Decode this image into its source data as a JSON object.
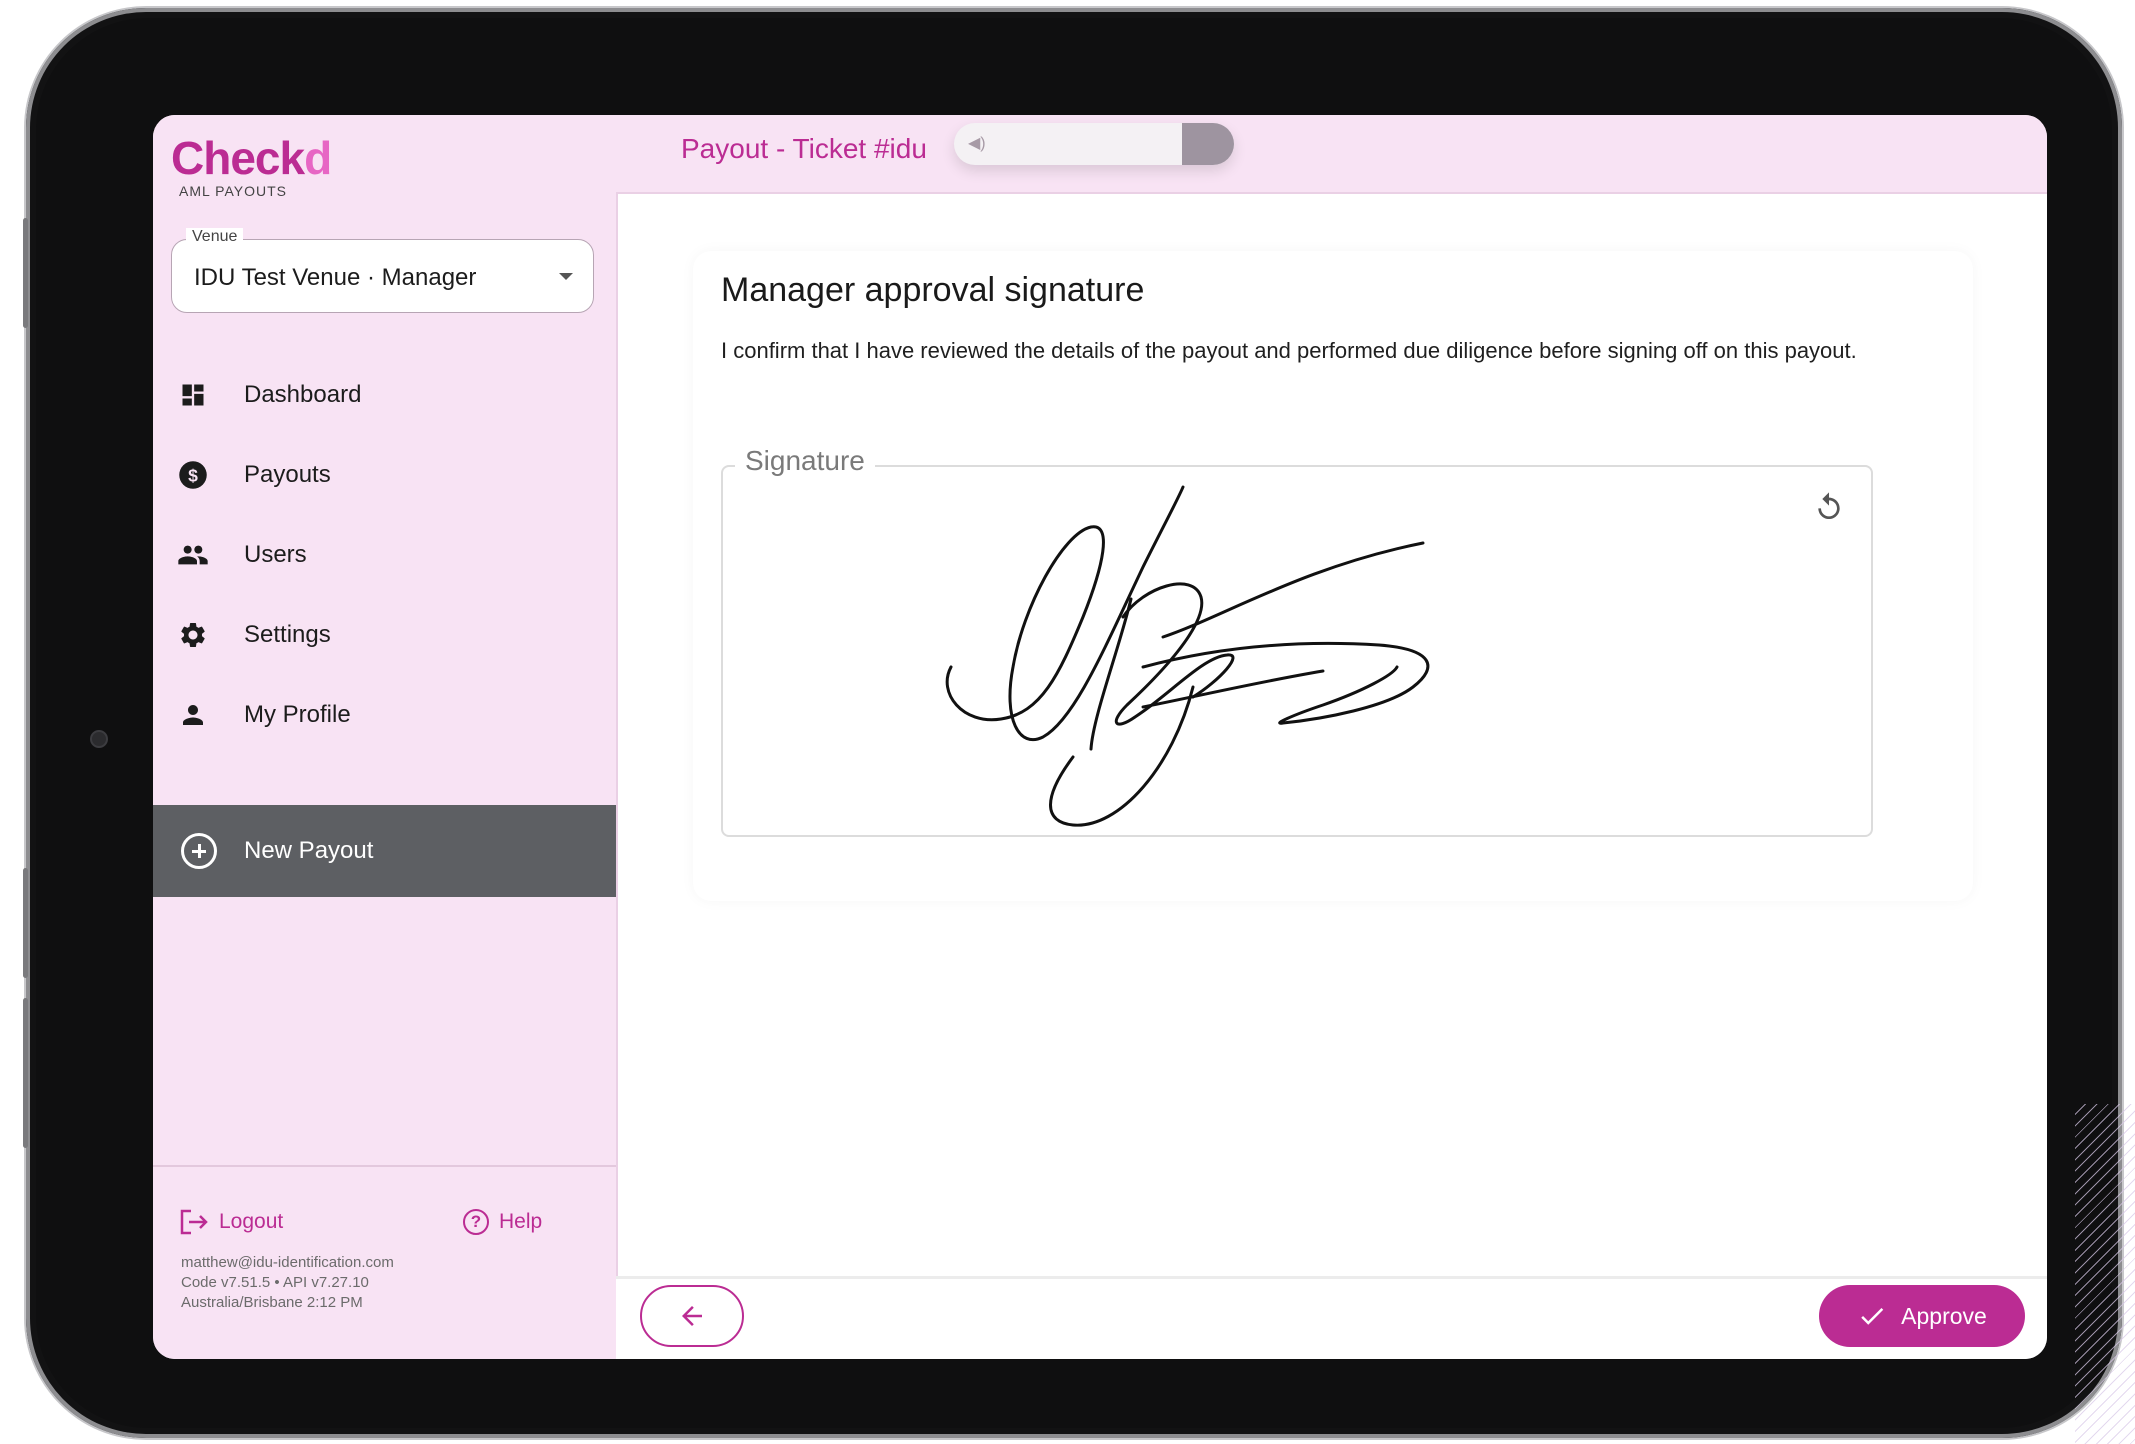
{
  "app": {
    "brand_main": "Check",
    "brand_accent": "d",
    "brand_subtitle": "AML PAYOUTS"
  },
  "venue": {
    "label": "Venue",
    "value": "IDU Test Venue · Manager"
  },
  "nav": {
    "items": [
      {
        "label": "Dashboard",
        "icon": "dashboard-icon"
      },
      {
        "label": "Payouts",
        "icon": "dollar-icon"
      },
      {
        "label": "Users",
        "icon": "users-icon"
      },
      {
        "label": "Settings",
        "icon": "gear-icon"
      },
      {
        "label": "My Profile",
        "icon": "person-icon"
      }
    ],
    "new_payout_label": "New Payout"
  },
  "footer": {
    "logout_label": "Logout",
    "help_label": "Help",
    "email": "matthew@idu-identification.com",
    "version": "Code v7.51.5 • API v7.27.10",
    "timezone_time": "Australia/Brisbane 2:12 PM"
  },
  "header": {
    "title": "Payout - Ticket #idu"
  },
  "main": {
    "card_title": "Manager approval signature",
    "confirmation_text": "I confirm that I have reviewed the details of the payout and performed due diligence before signing off on this payout.",
    "signature_label": "Signature"
  },
  "actions": {
    "approve_label": "Approve"
  },
  "colors": {
    "accent": "#bb2c93",
    "sidebar_bg": "#f8e3f4",
    "selected_nav_bg": "#5d5f63"
  }
}
